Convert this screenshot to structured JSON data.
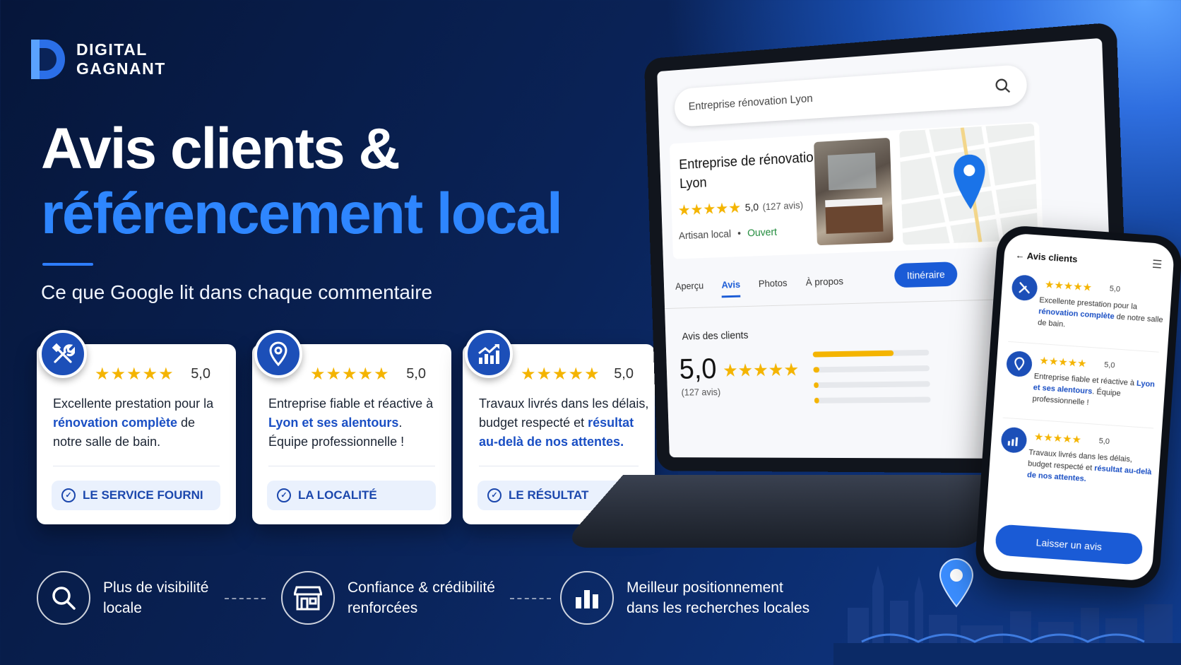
{
  "brand": {
    "line1": "DIGITAL",
    "line2": "GAGNANT"
  },
  "hero": {
    "title_line1": "Avis clients &",
    "title_line2": "référencement local",
    "subtitle": "Ce que Google lit dans chaque commentaire"
  },
  "colors": {
    "accent": "#2e86ff",
    "brand_blue": "#1c4fb8",
    "star": "#f4b400",
    "open_green": "#1f8a3a"
  },
  "cards": [
    {
      "icon": "tools-icon",
      "stars": "★★★★★",
      "score": "5,0",
      "text_a": "Excellente prestation pour la ",
      "text_b": "rénovation complète",
      "text_c": " de notre salle de bain.",
      "tag": "LE SERVICE FOURNI"
    },
    {
      "icon": "location-pin-icon",
      "stars": "★★★★★",
      "score": "5,0",
      "text_a": "Entreprise fiable et réactive à ",
      "text_b": "Lyon et ses alentours",
      "text_c": ". Équipe professionnelle !",
      "tag": "LA LOCALITÉ"
    },
    {
      "icon": "growth-chart-icon",
      "stars": "★★★★★",
      "score": "5,0",
      "text_a": "Travaux livrés dans les délais, budget respecté et ",
      "text_b": "résultat au-delà de nos attentes",
      "text_c": ".",
      "tag": "LE RÉSULTAT"
    }
  ],
  "benefits": [
    {
      "icon": "search-icon",
      "line1": "Plus de visibilité",
      "line2": "locale"
    },
    {
      "icon": "store-icon",
      "line1": "Confiance & crédibilité",
      "line2": "renforcées"
    },
    {
      "icon": "bar-chart-icon",
      "line1": "Meilleur positionnement",
      "line2": "dans les recherches locales"
    }
  ],
  "laptop": {
    "search_query": "Entreprise rénovation Lyon",
    "business_name_1": "Entreprise de rénovation",
    "business_name_2": "Lyon",
    "stars": "★★★★★",
    "rating": "5,0",
    "review_count": "(127 avis)",
    "category": "Artisan local",
    "status": "Ouvert",
    "itinerary_button": "Itinéraire",
    "tabs": [
      "Aperçu",
      "Avis",
      "Photos",
      "À propos"
    ],
    "active_tab": "Avis",
    "reviews_heading": "Avis des clients",
    "big_rating": "5,0",
    "big_count": "(127 avis)",
    "distribution": [
      0.7,
      0.05,
      0.03,
      0.02
    ]
  },
  "phone": {
    "header": "Avis clients",
    "items": [
      {
        "stars": "★★★★★",
        "score": "5,0",
        "text_a": "Excellente prestation pour la ",
        "text_b": "rénovation complète",
        "text_c": " de notre salle de bain."
      },
      {
        "stars": "★★★★★",
        "score": "5,0",
        "text_a": "Entreprise fiable et réactive à ",
        "text_b": "Lyon et ses alentours",
        "text_c": ". Équipe professionnelle !"
      },
      {
        "stars": "★★★★★",
        "score": "5,0",
        "text_a": "Travaux livrés dans les délais, budget respecté et ",
        "text_b": "résultat au-delà de nos attentes",
        "text_c": "."
      }
    ],
    "cta": "Laisser un avis"
  }
}
